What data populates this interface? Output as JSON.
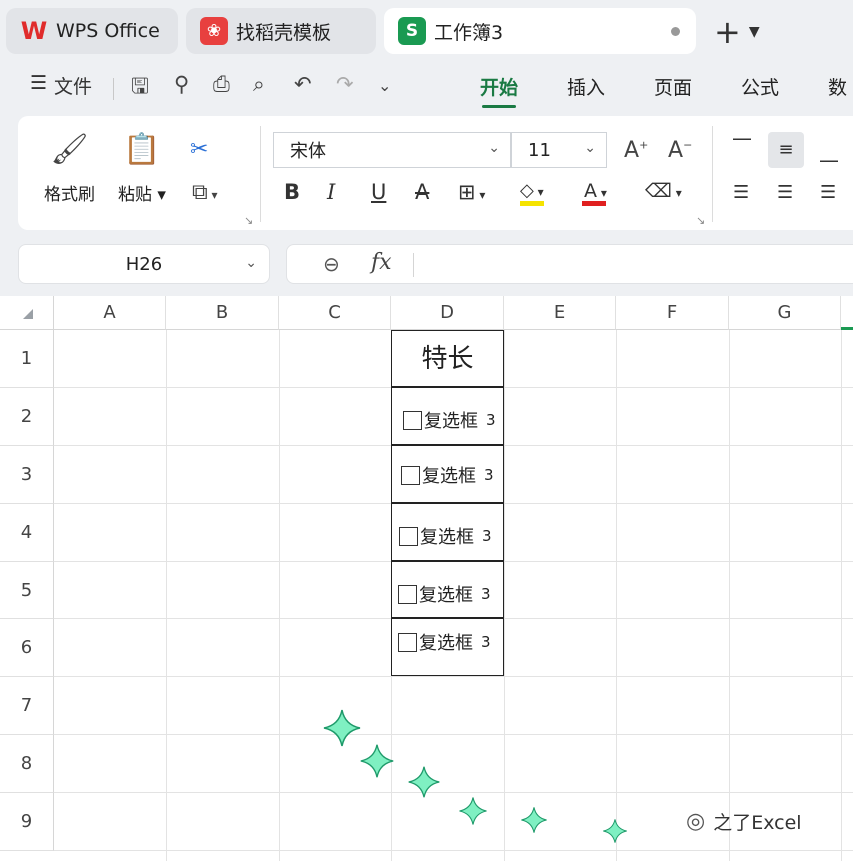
{
  "tabs": [
    {
      "label": "WPS Office",
      "logo": "W",
      "logo_color": "#e02b2b"
    },
    {
      "label": "找稻壳模板",
      "logo": "D",
      "logo_color": "#e8403f"
    },
    {
      "label": "工作簿3",
      "logo": "S",
      "logo_color": "#1a9a52",
      "active": true
    }
  ],
  "menu": {
    "file_label": "文件",
    "tabs": [
      "开始",
      "插入",
      "页面",
      "公式",
      "数"
    ]
  },
  "ribbon": {
    "format_painter": "格式刷",
    "paste": "粘贴",
    "font_name": "宋体",
    "font_size": "11",
    "bold": "B",
    "italic": "I",
    "underline": "U",
    "strike": "A",
    "highlight_color": "#f5e300",
    "font_color": "#e02020"
  },
  "formula_bar": {
    "cell_ref": "H26",
    "fx": "fx",
    "formula": ""
  },
  "grid": {
    "columns": [
      "A",
      "B",
      "C",
      "D",
      "E",
      "F",
      "G"
    ],
    "rows": [
      "1",
      "2",
      "3",
      "4",
      "5",
      "6",
      "7",
      "8",
      "9"
    ],
    "d1": "特长",
    "checkboxes": [
      {
        "label": "复选框",
        "num": "3"
      },
      {
        "label": "复选框",
        "num": "3"
      },
      {
        "label": "复选框",
        "num": "3"
      },
      {
        "label": "复选框",
        "num": "3"
      },
      {
        "label": "复选框",
        "num": "3"
      }
    ]
  },
  "watermark": "之了Excel",
  "colors": {
    "accent_green": "#1a7a43",
    "sparkle": "#3fd69a"
  }
}
